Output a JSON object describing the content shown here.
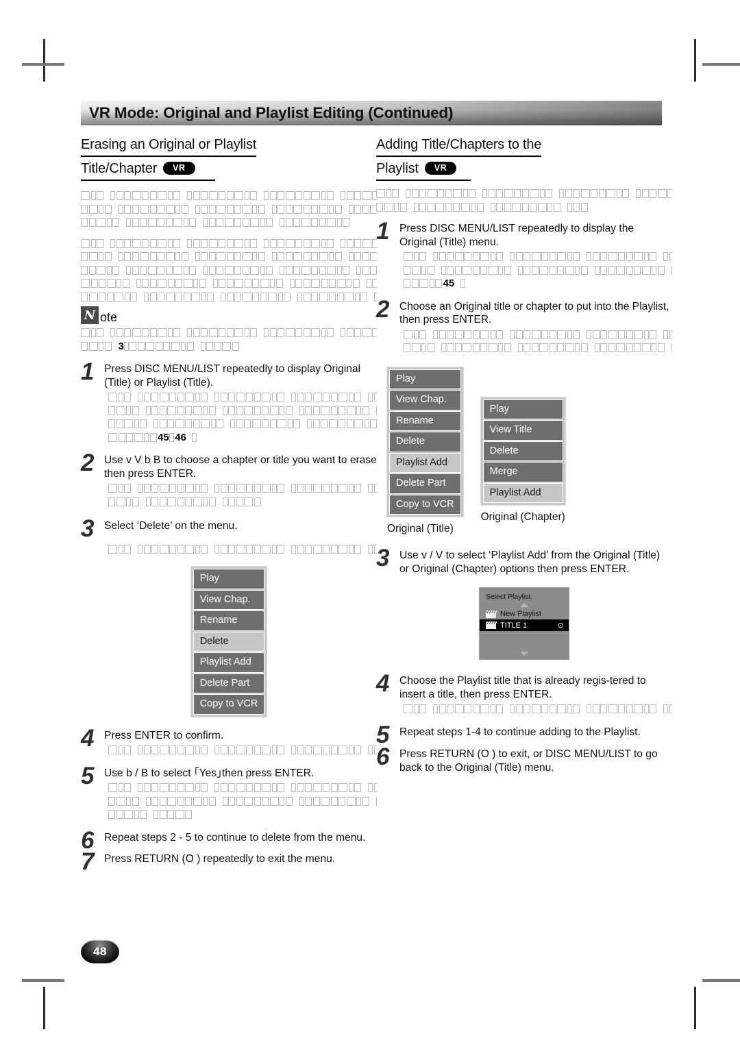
{
  "header": {
    "title": "VR Mode: Original and Playlist Editing (Continued)"
  },
  "page_number": "48",
  "badges": {
    "vr": "VR"
  },
  "note": {
    "word": "ote",
    "icon": "N"
  },
  "left_column": {
    "heading_line1": "Erasing an Original or Playlist",
    "heading_line2": "Title/Chapter",
    "steps": [
      {
        "num": "1",
        "text": "Press DISC MENU/LIST repeatedly to display Original (Title) or Playlist (Title)."
      },
      {
        "num": "2",
        "text": "Use v V b B  to choose a chapter or title you want to erase then press ENTER."
      },
      {
        "num": "3",
        "text": "Select ‘Delete’ on the menu."
      },
      {
        "num": "4",
        "text": "Press ENTER to confirm."
      },
      {
        "num": "5",
        "text": "Use b / B to select ｢Yes｣then press ENTER."
      },
      {
        "num": "6",
        "text": "Repeat steps 2 - 5 to continue to delete from the menu."
      },
      {
        "num": "7",
        "text": "Press RETURN (O ) repeatedly to exit the menu."
      }
    ],
    "inline_refs": {
      "step1": [
        "45",
        "46"
      ],
      "note": "3"
    },
    "menu": {
      "items": [
        "Play",
        "View Chap.",
        "Rename",
        "Delete",
        "Playlist Add",
        "Delete Part",
        "Copy to VCR"
      ],
      "selected": "Delete"
    }
  },
  "right_column": {
    "heading_line1": "Adding Title/Chapters to the",
    "heading_line2": "Playlist",
    "steps": [
      {
        "num": "1",
        "text": "Press DISC MENU/LIST repeatedly to display the Original (Title) menu."
      },
      {
        "num": "2",
        "text": "Choose an Original title or chapter to put into the Playlist, then press ENTER."
      },
      {
        "num": "3",
        "text": "Use v / V to select ‘Playlist Add’ from the Original (Title) or Original (Chapter) options then press ENTER."
      },
      {
        "num": "4",
        "text": "Choose the Playlist title that is already regis-tered to insert a title, then press ENTER."
      },
      {
        "num": "5",
        "text": "Repeat steps 1-4 to continue adding to the Playlist."
      },
      {
        "num": "6",
        "text": "Press RETURN (O ) to exit, or DISC MENU/LIST to go back to the Original (Title) menu."
      }
    ],
    "inline_refs": {
      "step1": [
        "45"
      ]
    },
    "menu_title": {
      "items": [
        "Play",
        "View Chap.",
        "Rename",
        "Delete",
        "Playlist Add",
        "Delete Part",
        "Copy to VCR"
      ],
      "selected": "Playlist Add",
      "caption": "Original (Title)"
    },
    "menu_chapter": {
      "items": [
        "Play",
        "View Title",
        "Delete",
        "Merge",
        "Playlist Add"
      ],
      "selected": "Playlist Add",
      "caption": "Original (Chapter)"
    },
    "dialog": {
      "title": "Select Playlist.",
      "rows": [
        {
          "label": "New Playlist",
          "selected": false,
          "mark": ""
        },
        {
          "label": "TITLE 1",
          "selected": true,
          "mark": "⊙"
        }
      ]
    }
  }
}
